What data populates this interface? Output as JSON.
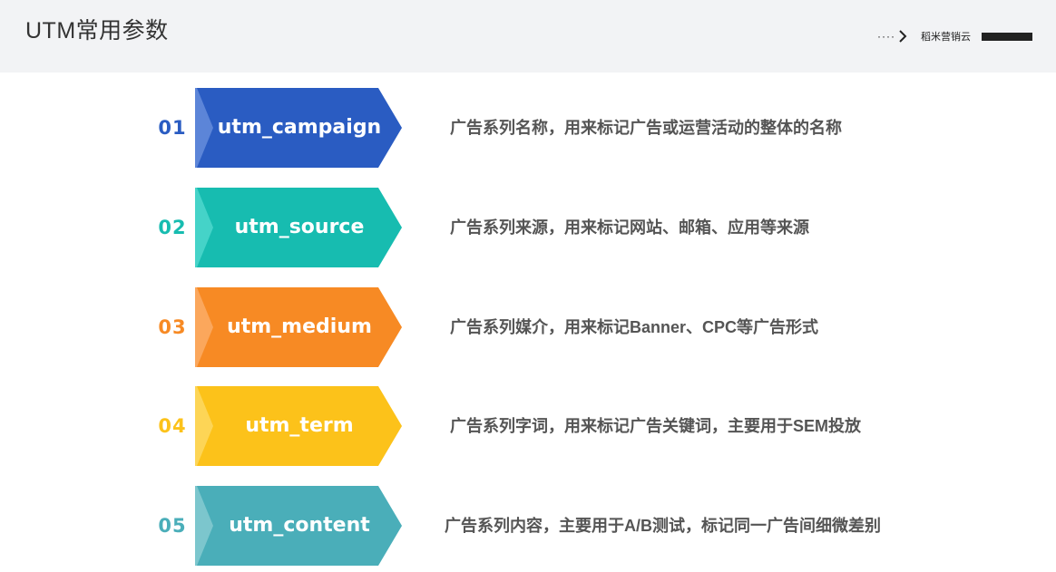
{
  "header": {
    "title": "UTM常用参数",
    "brand_dots": "····",
    "brand_name": "稻米营销云"
  },
  "items": [
    {
      "number": "01",
      "param": "utm_campaign",
      "description": "广告系列名称，用来标记广告或运营活动的整体的名称",
      "color": "#2a5cc2",
      "light": "#5c85d8"
    },
    {
      "number": "02",
      "param": "utm_source",
      "description": "广告系列来源，用来标记网站、邮箱、应用等来源",
      "color": "#17bcb0",
      "light": "#45d3c8"
    },
    {
      "number": "03",
      "param": "utm_medium",
      "description": "广告系列媒介，用来标记Banner、CPC等广告形式",
      "color": "#f78a24",
      "light": "#fba75c"
    },
    {
      "number": "04",
      "param": "utm_term",
      "description": "广告系列字词，用来标记广告关键词，主要用于SEM投放",
      "color": "#fcc21a",
      "light": "#fdd556"
    },
    {
      "number": "05",
      "param": "utm_content",
      "description": "广告系列内容，主要用于A/B测试，标记同一广告间细微差别",
      "color": "#4aaeb9",
      "light": "#7cc6cd"
    }
  ]
}
